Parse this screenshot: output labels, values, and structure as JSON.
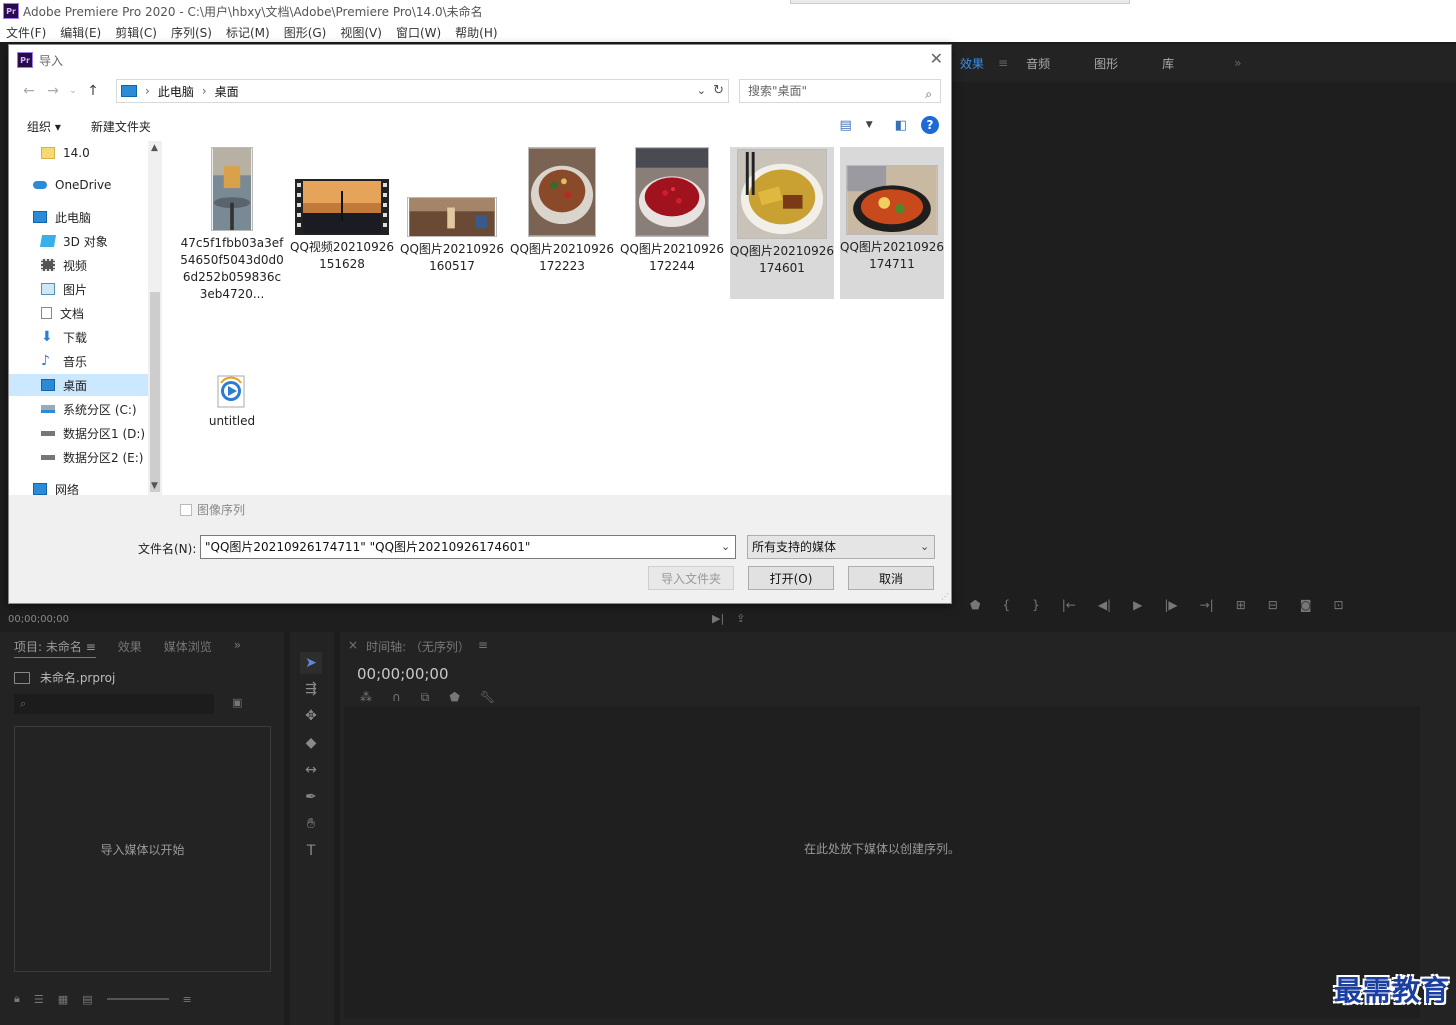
{
  "app": {
    "title": "Adobe Premiere Pro 2020 - C:\\用户\\hbxy\\文档\\Adobe\\Premiere Pro\\14.0\\未命名",
    "logo": "Pr",
    "menu": [
      "文件(F)",
      "编辑(E)",
      "剪辑(C)",
      "序列(S)",
      "标记(M)",
      "图形(G)",
      "视图(V)",
      "窗口(W)",
      "帮助(H)"
    ]
  },
  "right_tabs": {
    "effects": "效果",
    "effects_menu": "≡",
    "audio": "音频",
    "graphics": "图形",
    "libraries": "库",
    "more": "»"
  },
  "source_monitor": {
    "timecode": "00;00;00;00"
  },
  "project_panel": {
    "tab_project": "项目: 未命名",
    "tab_menu": "≡",
    "tab_effects": "效果",
    "tab_media_browser": "媒体浏览",
    "tabs_more": "»",
    "file_name": "未命名.prproj",
    "drop_hint": "导入媒体以开始"
  },
  "timeline": {
    "close": "×",
    "title": "时间轴: （无序列）",
    "menu": "≡",
    "timecode": "00;00;00;00",
    "drop_hint": "在此处放下媒体以创建序列。"
  },
  "watermark": "最需教育",
  "dialog": {
    "logo": "Pr",
    "title": "导入",
    "close": "✕",
    "breadcrumb": [
      "此电脑",
      "桌面"
    ],
    "search_placeholder": "搜索\"桌面\"",
    "organize": "组织 ▾",
    "new_folder": "新建文件夹",
    "help": "?",
    "nav_items": [
      {
        "label": "14.0",
        "icon": "folder-icon"
      },
      {
        "label": "OneDrive",
        "icon": "cloud-icon"
      },
      {
        "label": "此电脑",
        "icon": "computer-icon"
      },
      {
        "label": "3D 对象",
        "icon": "cube-icon"
      },
      {
        "label": "视频",
        "icon": "film-icon"
      },
      {
        "label": "图片",
        "icon": "picture-icon"
      },
      {
        "label": "文档",
        "icon": "document-icon"
      },
      {
        "label": "下载",
        "icon": "download-icon"
      },
      {
        "label": "音乐",
        "icon": "music-icon"
      },
      {
        "label": "桌面",
        "icon": "desktop-icon"
      },
      {
        "label": "系统分区 (C:)",
        "icon": "drive-icon"
      },
      {
        "label": "数据分区1 (D:)",
        "icon": "drive-icon"
      },
      {
        "label": "数据分区2 (E:)",
        "icon": "drive-icon"
      },
      {
        "label": "网络",
        "icon": "network-icon"
      }
    ],
    "files": [
      {
        "name": "47c5f1fbb03a3ef54650f5043d0d06d252b059836c3eb4720...",
        "selected": false
      },
      {
        "name": "QQ视频20210926151628",
        "selected": false
      },
      {
        "name": "QQ图片20210926160517",
        "selected": false
      },
      {
        "name": "QQ图片20210926172223",
        "selected": false
      },
      {
        "name": "QQ图片20210926172244",
        "selected": false
      },
      {
        "name": "QQ图片20210926174601",
        "selected": true
      },
      {
        "name": "QQ图片20210926174711",
        "selected": true
      },
      {
        "name": "untitled",
        "selected": false
      }
    ],
    "image_sequence_label": "图像序列",
    "filename_label": "文件名(N):",
    "filename_value": "\"QQ图片20210926174711\" \"QQ图片20210926174601\"",
    "filetype_value": "所有支持的媒体",
    "import_folder": "导入文件夹",
    "open": "打开(O)",
    "cancel": "取消"
  },
  "colors": {
    "accent_blue": "#1d6ad6",
    "selection": "#cce8ff",
    "panel_dark": "#232323",
    "effects_tab_active": "#3d8ee0"
  }
}
